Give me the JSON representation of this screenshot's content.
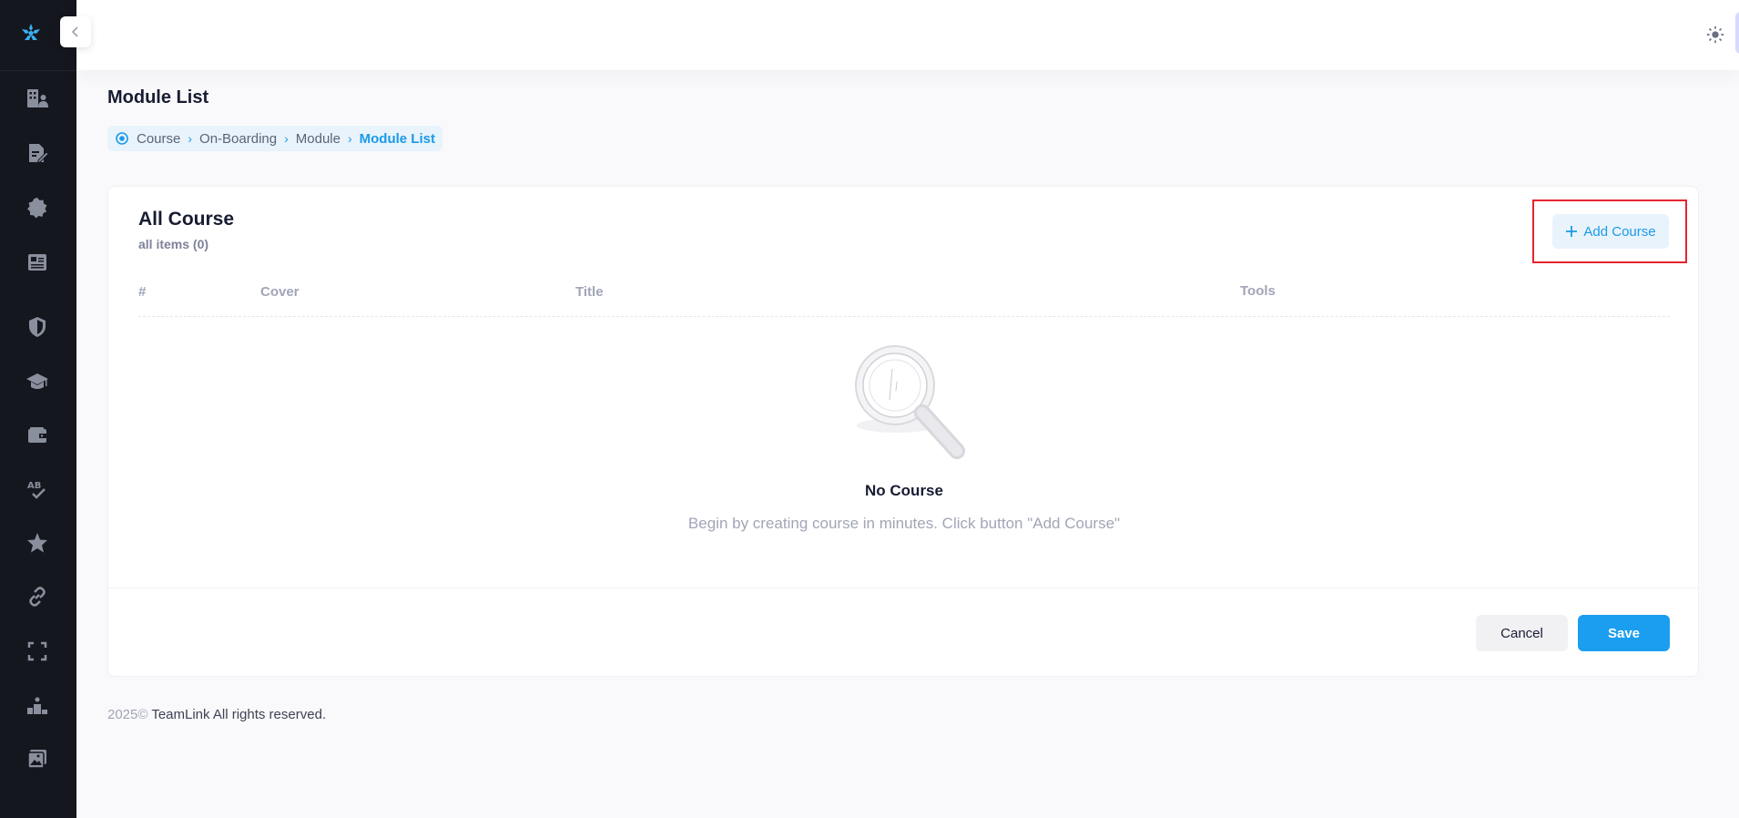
{
  "sidebar": {
    "items": [
      {
        "icon": "building-users-icon",
        "name": "sidebar-item-organization"
      },
      {
        "icon": "document-edit-icon",
        "name": "sidebar-item-documents"
      },
      {
        "icon": "badge-icon",
        "name": "sidebar-item-badges"
      },
      {
        "icon": "newspaper-icon",
        "name": "sidebar-item-news"
      },
      {
        "icon": "shield-icon",
        "name": "sidebar-item-security"
      },
      {
        "icon": "graduation-cap-icon",
        "name": "sidebar-item-courses"
      },
      {
        "icon": "wallet-icon",
        "name": "sidebar-item-wallet"
      },
      {
        "icon": "spellcheck-icon",
        "name": "sidebar-item-quiz"
      },
      {
        "icon": "star-icon",
        "name": "sidebar-item-favorites"
      },
      {
        "icon": "link-icon",
        "name": "sidebar-item-links"
      },
      {
        "icon": "fullscreen-icon",
        "name": "sidebar-item-fullscreen"
      },
      {
        "icon": "podium-icon",
        "name": "sidebar-item-leaderboard"
      },
      {
        "icon": "gallery-icon",
        "name": "sidebar-item-gallery"
      }
    ]
  },
  "header": {
    "theme_icon": "sun-icon",
    "avatar_icon": "user-avatar"
  },
  "page": {
    "title": "Module List"
  },
  "breadcrumb": {
    "items": [
      "Course",
      "On-Boarding",
      "Module",
      "Module List"
    ]
  },
  "card": {
    "title": "All Course",
    "subtitle": "all items (0)",
    "add_button": "Add Course",
    "columns": [
      "#",
      "Cover",
      "Title",
      "Tools"
    ],
    "empty_title": "No Course",
    "empty_desc": "Begin by creating course in minutes. Click button \"Add Course\"",
    "cancel": "Cancel",
    "save": "Save"
  },
  "footer": {
    "year": "2025©",
    "brand": "TeamLink All rights reserved."
  },
  "colors": {
    "sidebar_bg": "#15171e",
    "primary": "#1b9ef0",
    "highlight": "#e3262f"
  }
}
